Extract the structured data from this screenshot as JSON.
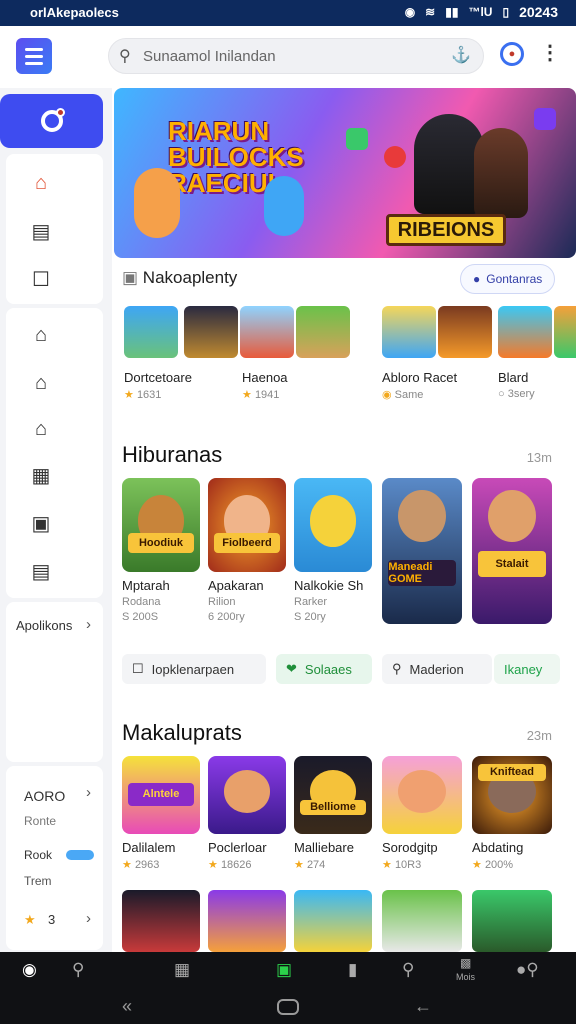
{
  "status_bar": {
    "title": "orlAkepaolecs",
    "time": "20243",
    "signal": "☺",
    "network": "™lU"
  },
  "app_bar": {
    "search_placeholder": "Sunaamol Inilandan"
  },
  "sidebar": {
    "apps_label": "Apolikons",
    "section1": {
      "title": "AORO",
      "subtitle": "Ronte"
    },
    "toggle_label": "Rook",
    "section2": {
      "label": "Trem"
    },
    "rating": "3"
  },
  "featured_row": {
    "title": "Nakoaplenty",
    "action": "Gontanras",
    "items": [
      {
        "name": "Dortcetoare",
        "meta": "1631"
      },
      {
        "name": "Haenoa",
        "meta": "1941"
      },
      {
        "name": "Abloro Racet",
        "meta": "Same"
      },
      {
        "name": "Blard",
        "meta": "3sery"
      }
    ]
  },
  "hiburanas": {
    "title": "Hiburanas",
    "meta": "13m",
    "items": [
      {
        "name": "Mptarah",
        "sub": "Rodana",
        "meta": "S 200S"
      },
      {
        "name": "Apakaran",
        "sub": "Rilion",
        "meta": "6 200ry"
      },
      {
        "name": "Nalkokie Sh",
        "sub": "Rarker",
        "meta": "S 20ry"
      }
    ],
    "poster_labels": [
      "Hoodiuk",
      "Fiolbeerd",
      "Maneadi GOME",
      "Stalait"
    ]
  },
  "filters": [
    {
      "label": "Iopklenarpaen"
    },
    {
      "label": "Solaaes"
    },
    {
      "label": "Maderion"
    },
    {
      "label": "Ikaney"
    }
  ],
  "makaluprats": {
    "title": "Makaluprats",
    "meta": "23m",
    "items": [
      {
        "name": "Dalilalem",
        "meta": "2963",
        "art": "Alntele"
      },
      {
        "name": "Poclerloar",
        "meta": "18626",
        "art": ""
      },
      {
        "name": "Malliebare",
        "meta": "274",
        "art": "Belliome"
      },
      {
        "name": "Sorodgitp",
        "meta": "10R3",
        "art": ""
      },
      {
        "name": "Abdating",
        "meta": "200%",
        "art": "Kniftead"
      }
    ]
  },
  "bottom_nav": {
    "mini_label": "Mois"
  },
  "banner": {
    "headline": "RIARUN BUILOCKS RAECIUI",
    "ribbon": "RIBEIONS"
  },
  "colors": {
    "accent": "#3e4cf0",
    "status_bar": "#0d2a5e",
    "green": "#2cd14b"
  }
}
